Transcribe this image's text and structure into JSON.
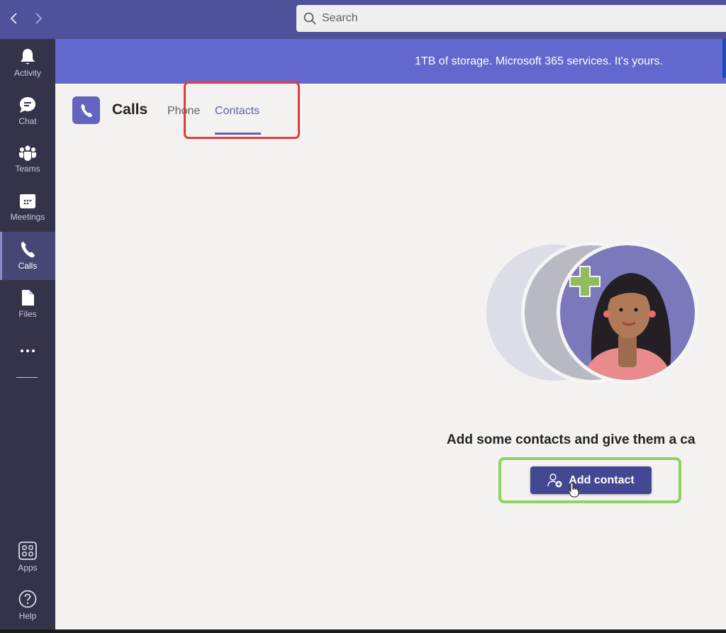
{
  "titlebar": {
    "back_icon": "chevron-left-icon",
    "forward_icon": "chevron-right-icon",
    "search": {
      "placeholder": "Search",
      "value": ""
    }
  },
  "banner": {
    "text": "1TB of storage. Microsoft 365 services. It's yours."
  },
  "rail": {
    "items": [
      {
        "label": "Activity",
        "icon": "bell-icon",
        "active": false
      },
      {
        "label": "Chat",
        "icon": "chat-icon",
        "active": false
      },
      {
        "label": "Teams",
        "icon": "teams-icon",
        "active": false
      },
      {
        "label": "Meetings",
        "icon": "calendar-icon",
        "active": false
      },
      {
        "label": "Calls",
        "icon": "phone-icon",
        "active": true
      },
      {
        "label": "Files",
        "icon": "file-icon",
        "active": false
      }
    ],
    "more_icon": "more-icon",
    "bottom_items": [
      {
        "label": "Apps",
        "icon": "apps-icon"
      },
      {
        "label": "Help",
        "icon": "help-icon"
      }
    ]
  },
  "header": {
    "title": "Calls",
    "tabs": [
      {
        "label": "Phone",
        "active": false
      },
      {
        "label": "Contacts",
        "active": true
      }
    ]
  },
  "empty_state": {
    "message": "Add some contacts and give them a ca",
    "button_label": "Add contact"
  },
  "colors": {
    "brand": "#6264a7",
    "titlebar": "#4f529b",
    "rail": "#33344a",
    "banner": "#6368ce",
    "button": "#444791",
    "annotation_red": "#e33b3b",
    "annotation_green": "#8dd263"
  }
}
